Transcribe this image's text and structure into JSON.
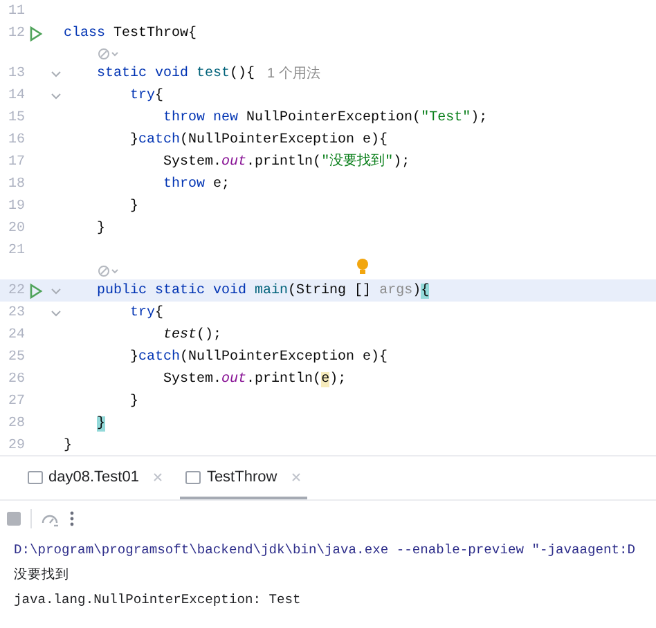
{
  "editor": {
    "rows": [
      {
        "kind": "code",
        "number": "11",
        "runnable": false,
        "foldable": false,
        "current": false,
        "tokens": []
      },
      {
        "kind": "code",
        "number": "12",
        "runnable": true,
        "foldable": false,
        "current": false,
        "tokens": [
          {
            "kind": "kw",
            "text": "class"
          },
          {
            "kind": "plain",
            "text": " TestThrow{"
          }
        ]
      },
      {
        "kind": "hint",
        "lightbulb": false
      },
      {
        "kind": "code",
        "number": "13",
        "runnable": false,
        "foldable": true,
        "current": false,
        "usages": "1 个用法",
        "tokens": [
          {
            "kind": "kw",
            "text": "    static void "
          },
          {
            "kind": "method",
            "text": "test"
          },
          {
            "kind": "plain",
            "text": "(){"
          }
        ]
      },
      {
        "kind": "code",
        "number": "14",
        "runnable": false,
        "foldable": true,
        "current": false,
        "tokens": [
          {
            "kind": "kw",
            "text": "        try"
          },
          {
            "kind": "plain",
            "text": "{"
          }
        ]
      },
      {
        "kind": "code",
        "number": "15",
        "runnable": false,
        "foldable": false,
        "current": false,
        "tokens": [
          {
            "kind": "kw",
            "text": "            throw new"
          },
          {
            "kind": "plain",
            "text": " NullPointerException("
          },
          {
            "kind": "str",
            "text": "\"Test\""
          },
          {
            "kind": "plain",
            "text": ");"
          }
        ]
      },
      {
        "kind": "code",
        "number": "16",
        "runnable": false,
        "foldable": false,
        "current": false,
        "tokens": [
          {
            "kind": "plain",
            "text": "        }"
          },
          {
            "kind": "kw",
            "text": "catch"
          },
          {
            "kind": "plain",
            "text": "(NullPointerException e){"
          }
        ]
      },
      {
        "kind": "code",
        "number": "17",
        "runnable": false,
        "foldable": false,
        "current": false,
        "tokens": [
          {
            "kind": "plain",
            "text": "            System."
          },
          {
            "kind": "field",
            "text": "out"
          },
          {
            "kind": "plain",
            "text": ".println("
          },
          {
            "kind": "str",
            "text": "\"没要找到\""
          },
          {
            "kind": "plain",
            "text": ");"
          }
        ]
      },
      {
        "kind": "code",
        "number": "18",
        "runnable": false,
        "foldable": false,
        "current": false,
        "tokens": [
          {
            "kind": "kw",
            "text": "            throw"
          },
          {
            "kind": "plain",
            "text": " e;"
          }
        ]
      },
      {
        "kind": "code",
        "number": "19",
        "runnable": false,
        "foldable": false,
        "current": false,
        "tokens": [
          {
            "kind": "plain",
            "text": "        }"
          }
        ]
      },
      {
        "kind": "code",
        "number": "20",
        "runnable": false,
        "foldable": false,
        "current": false,
        "tokens": [
          {
            "kind": "plain",
            "text": "    }"
          }
        ]
      },
      {
        "kind": "code",
        "number": "21",
        "runnable": false,
        "foldable": false,
        "current": false,
        "tokens": []
      },
      {
        "kind": "hint",
        "lightbulb": true
      },
      {
        "kind": "code",
        "number": "22",
        "runnable": true,
        "foldable": true,
        "current": true,
        "tokens": [
          {
            "kind": "kw",
            "text": "    public static void "
          },
          {
            "kind": "method",
            "text": "main"
          },
          {
            "kind": "plain",
            "text": "(String [] "
          },
          {
            "kind": "unused",
            "text": "args"
          },
          {
            "kind": "plain",
            "text": ")"
          },
          {
            "kind": "match",
            "text": "{"
          }
        ]
      },
      {
        "kind": "code",
        "number": "23",
        "runnable": false,
        "foldable": true,
        "current": false,
        "tokens": [
          {
            "kind": "kw",
            "text": "        try"
          },
          {
            "kind": "plain",
            "text": "{"
          }
        ]
      },
      {
        "kind": "code",
        "number": "24",
        "runnable": false,
        "foldable": false,
        "current": false,
        "tokens": [
          {
            "kind": "static",
            "text": "            test"
          },
          {
            "kind": "plain",
            "text": "();"
          }
        ]
      },
      {
        "kind": "code",
        "number": "25",
        "runnable": false,
        "foldable": false,
        "current": false,
        "tokens": [
          {
            "kind": "plain",
            "text": "        }"
          },
          {
            "kind": "kw",
            "text": "catch"
          },
          {
            "kind": "plain",
            "text": "(NullPointerException e){"
          }
        ]
      },
      {
        "kind": "code",
        "number": "26",
        "runnable": false,
        "foldable": false,
        "current": false,
        "tokens": [
          {
            "kind": "plain",
            "text": "            System."
          },
          {
            "kind": "field",
            "text": "out"
          },
          {
            "kind": "plain",
            "text": ".println("
          },
          {
            "kind": "usage",
            "text": "e"
          },
          {
            "kind": "plain",
            "text": ");"
          }
        ]
      },
      {
        "kind": "code",
        "number": "27",
        "runnable": false,
        "foldable": false,
        "current": false,
        "tokens": [
          {
            "kind": "plain",
            "text": "        }"
          }
        ]
      },
      {
        "kind": "code",
        "number": "28",
        "runnable": false,
        "foldable": false,
        "current": false,
        "tokens": [
          {
            "kind": "match",
            "text": "    }"
          }
        ]
      },
      {
        "kind": "code",
        "number": "29",
        "runnable": false,
        "foldable": false,
        "current": false,
        "tokens": [
          {
            "kind": "plain",
            "text": "}"
          }
        ]
      }
    ]
  },
  "run_tabs": [
    {
      "label": "day08.Test01",
      "selected": false
    },
    {
      "label": "TestThrow",
      "selected": true
    }
  ],
  "console": [
    {
      "kind": "command",
      "text": "D:\\program\\programsoft\\backend\\jdk\\bin\\java.exe --enable-preview \"-javaagent:D"
    },
    {
      "kind": "output",
      "text": "没要找到"
    },
    {
      "kind": "output",
      "text": "java.lang.NullPointerException: Test"
    }
  ]
}
